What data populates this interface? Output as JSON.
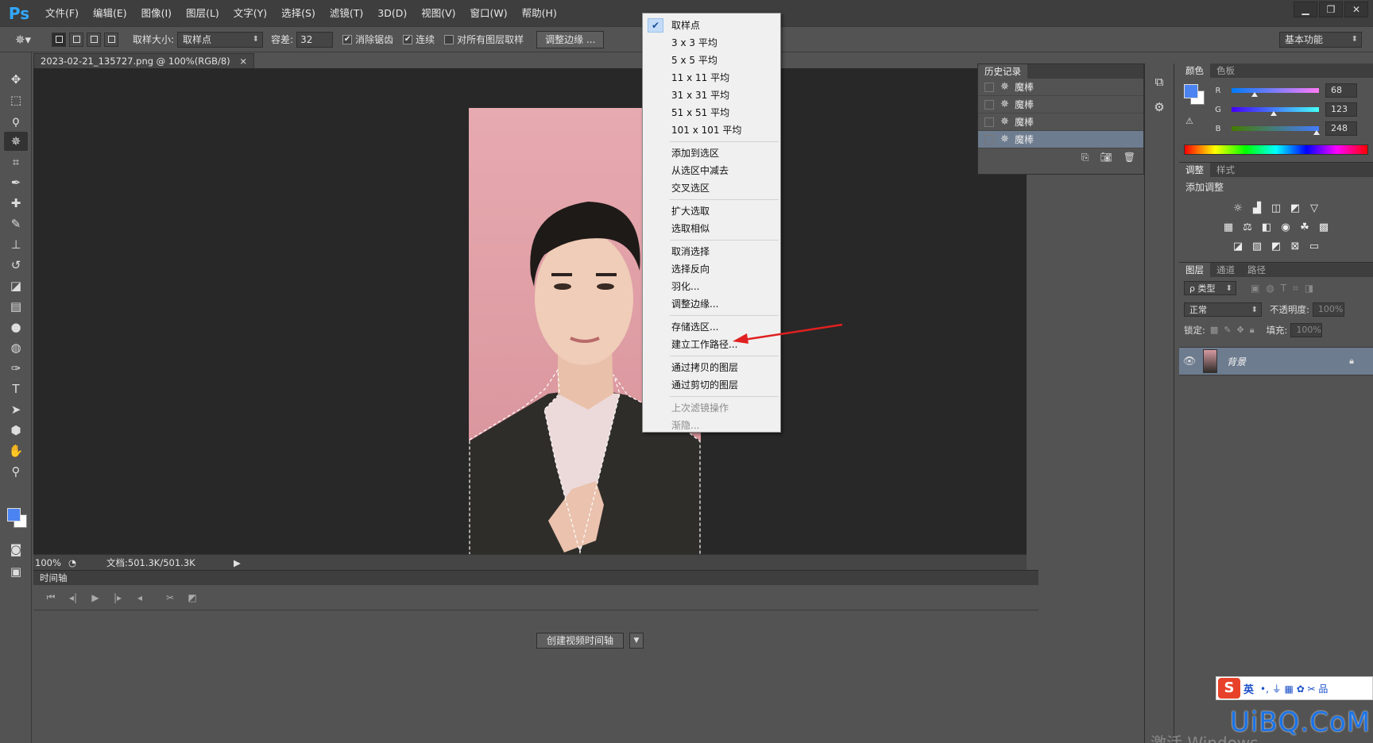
{
  "app": {
    "logo": "Ps"
  },
  "menu": [
    "文件(F)",
    "编辑(E)",
    "图像(I)",
    "图层(L)",
    "文字(Y)",
    "选择(S)",
    "滤镜(T)",
    "3D(D)",
    "视图(V)",
    "窗口(W)",
    "帮助(H)"
  ],
  "window_controls": {
    "minimize": "▁",
    "restore": "❐",
    "close": "✕"
  },
  "options": {
    "sample_size_label": "取样大小:",
    "sample_size_value": "取样点",
    "tolerance_label": "容差:",
    "tolerance_value": "32",
    "antialias_label": "消除锯齿",
    "antialias_checked": "✔",
    "contiguous_label": "连续",
    "contiguous_checked": "✔",
    "all_layers_label": "对所有图层取样",
    "refine_edge_button": "调整边缘 ...",
    "workspace": "基本功能"
  },
  "document": {
    "tab_title": "2023-02-21_135727.png @ 100%(RGB/8)",
    "tab_close": "×",
    "zoom": "100%",
    "doc_info": "文档:501.3K/501.3K"
  },
  "timeline": {
    "title": "时间轴",
    "create_button": "创建视频时间轴"
  },
  "history": {
    "title": "历史记录",
    "rows": [
      "魔棒",
      "魔棒",
      "魔棒",
      "魔棒"
    ]
  },
  "color_panel": {
    "tabs": [
      "颜色",
      "色板"
    ],
    "r_label": "R",
    "r_value": "68",
    "g_label": "G",
    "g_value": "123",
    "b_label": "B",
    "b_value": "248",
    "r_level": 0.267,
    "g_level": 0.482,
    "b_level": 0.973,
    "foreground": "#4b83f0",
    "background": "#ffffff"
  },
  "adjust_panel": {
    "tabs": [
      "调整",
      "样式"
    ],
    "add_label": "添加调整"
  },
  "layers_panel": {
    "tabs": [
      "图层",
      "通道",
      "路径"
    ],
    "filter_label": "ρ 类型",
    "blend_mode": "正常",
    "opacity_label": "不透明度:",
    "opacity_value": "100%",
    "lock_label": "锁定:",
    "fill_label": "填充:",
    "fill_value": "100%",
    "layer_name": "背景"
  },
  "context_menu": {
    "checked_mark": "✔",
    "items": [
      {
        "label": "取样点",
        "checked": true
      },
      {
        "label": "3 x 3 平均"
      },
      {
        "label": "5 x 5 平均"
      },
      {
        "label": "11 x 11 平均"
      },
      {
        "label": "31 x 31 平均"
      },
      {
        "label": "51 x 51 平均"
      },
      {
        "label": "101 x 101 平均"
      },
      {
        "sep": true
      },
      {
        "label": "添加到选区"
      },
      {
        "label": "从选区中减去"
      },
      {
        "label": "交叉选区"
      },
      {
        "sep": true
      },
      {
        "label": "扩大选取"
      },
      {
        "label": "选取相似"
      },
      {
        "sep": true
      },
      {
        "label": "取消选择"
      },
      {
        "label": "选择反向"
      },
      {
        "label": "羽化..."
      },
      {
        "label": "调整边缘..."
      },
      {
        "sep": true
      },
      {
        "label": "存储选区..."
      },
      {
        "label": "建立工作路径..."
      },
      {
        "sep": true
      },
      {
        "label": "通过拷贝的图层"
      },
      {
        "label": "通过剪切的图层"
      },
      {
        "sep": true
      },
      {
        "label": "上次滤镜操作",
        "disabled": true
      },
      {
        "label": "渐隐...",
        "disabled": true
      }
    ]
  },
  "overlay": {
    "ime_logo": "S",
    "ime_lang": "英",
    "ime_extra": "•, ⏚ ▦ ✿ ✂ 品",
    "watermark": "UiBQ.CoM",
    "activate": "激活 Windows"
  }
}
